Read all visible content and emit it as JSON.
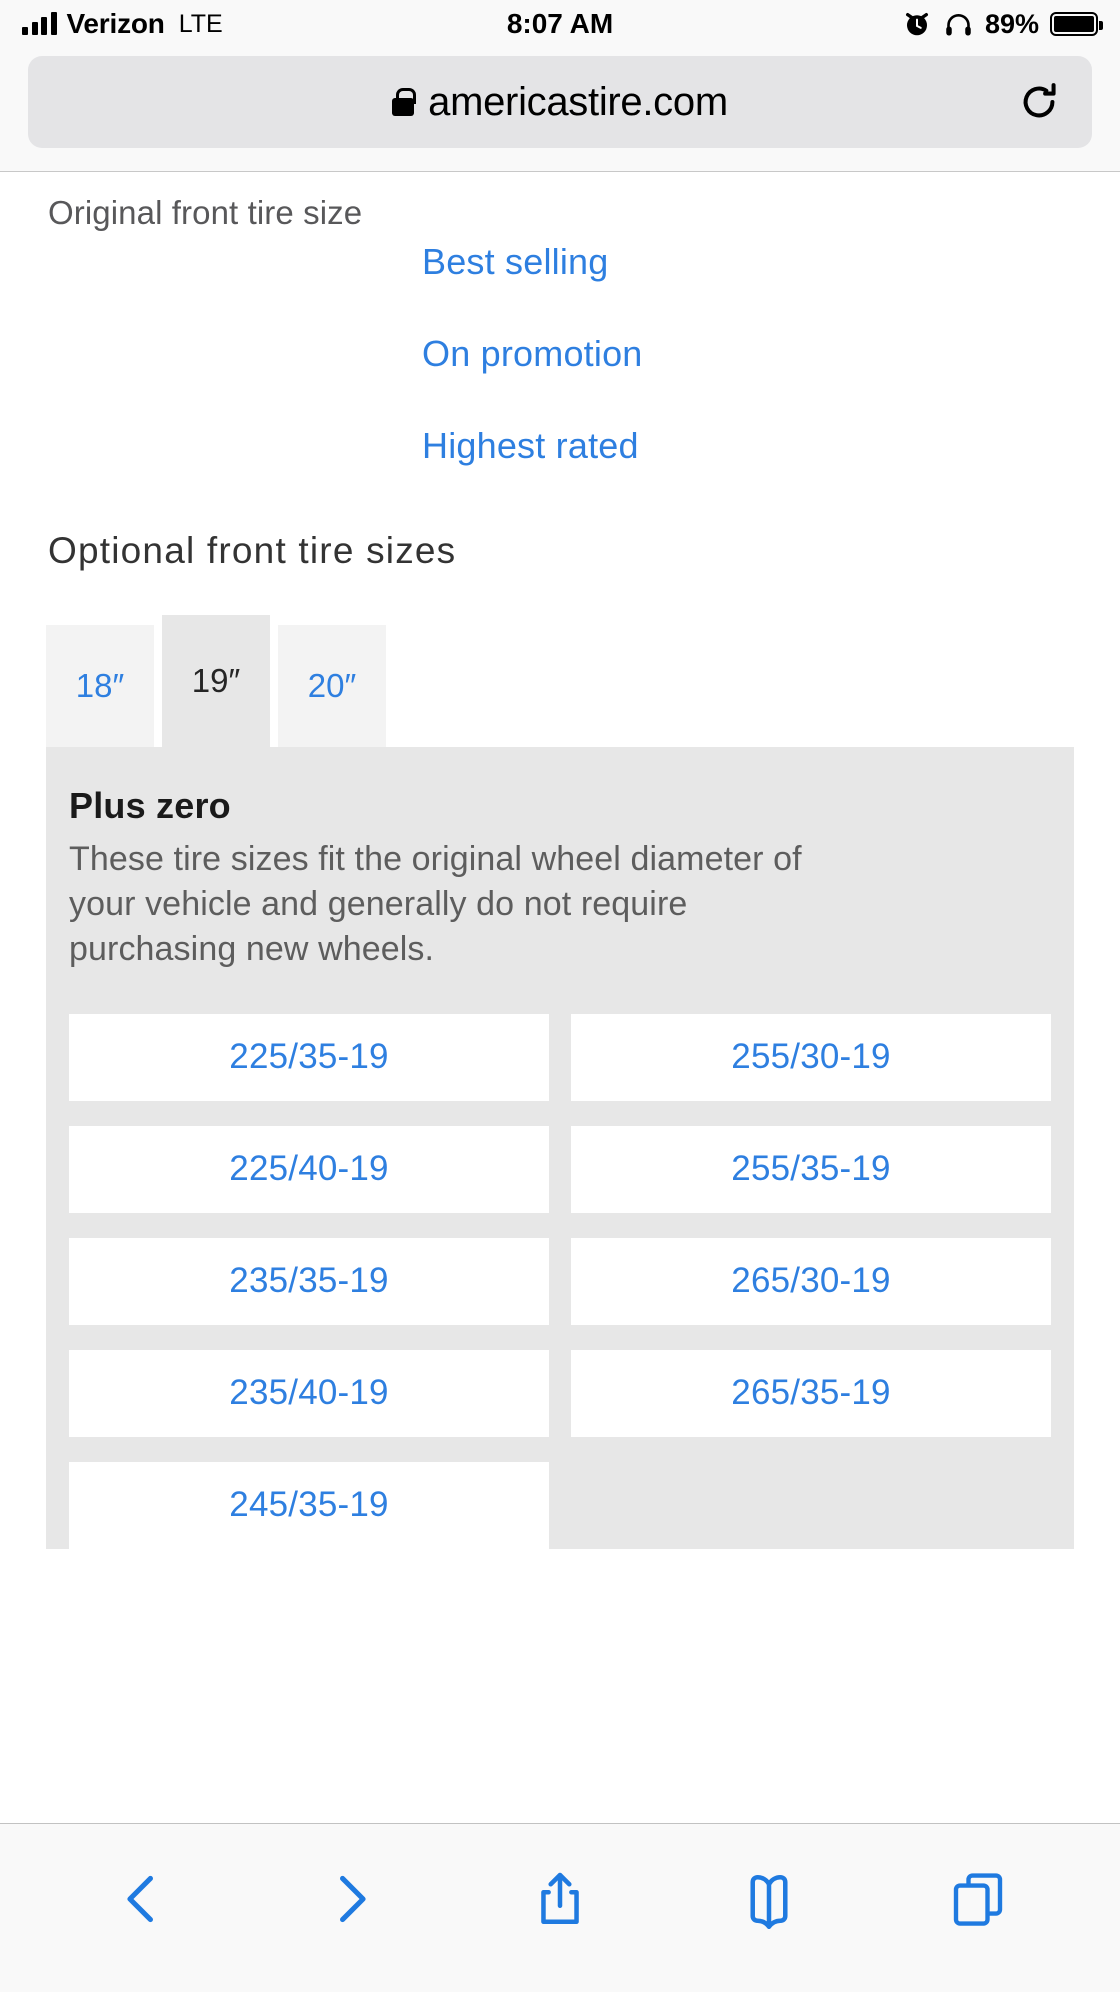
{
  "status_bar": {
    "carrier": "Verizon",
    "network": "LTE",
    "time": "8:07 AM",
    "battery_percent": "89%",
    "icons": [
      "signal-bars-icon",
      "alarm-clock-icon",
      "headphones-icon",
      "battery-icon"
    ]
  },
  "browser": {
    "url": "americastire.com",
    "lock_icon": "lock-icon",
    "reload_icon": "reload-icon",
    "toolbar": [
      {
        "name": "back-button",
        "icon": "chevron-left-icon"
      },
      {
        "name": "forward-button",
        "icon": "chevron-right-icon"
      },
      {
        "name": "share-button",
        "icon": "share-icon"
      },
      {
        "name": "bookmarks-button",
        "icon": "book-icon"
      },
      {
        "name": "tabs-button",
        "icon": "tabs-icon"
      }
    ]
  },
  "page": {
    "original_size_label": "Original front tire size",
    "sort_links": [
      "Best selling",
      "On promotion",
      "Highest rated"
    ],
    "section_title": "Optional front tire sizes",
    "diameter_tabs": [
      {
        "label": "18″",
        "active": false
      },
      {
        "label": "19″",
        "active": true
      },
      {
        "label": "20″",
        "active": false
      }
    ],
    "panel": {
      "title": "Plus zero",
      "description": "These tire sizes fit the original wheel diameter of your vehicle and generally do not require purchasing new wheels.",
      "sizes": [
        "225/35-19",
        "255/30-19",
        "225/40-19",
        "255/35-19",
        "235/35-19",
        "265/30-19",
        "235/40-19",
        "265/35-19",
        "245/35-19"
      ]
    }
  },
  "colors": {
    "link_blue": "#2e7fe0",
    "toolbar_blue": "#1f7ae0",
    "panel_gray": "#e7e7e7",
    "tab_gray": "#f3f3f3",
    "chrome_gray": "#f9f9f9"
  }
}
